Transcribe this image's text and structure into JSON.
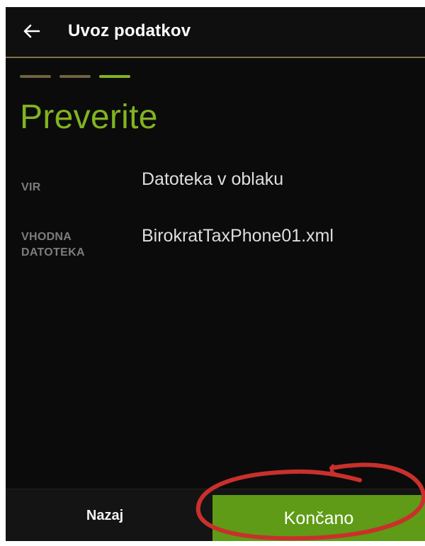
{
  "app_bar": {
    "title": "Uvoz podatkov",
    "back_icon": "arrow-left-icon"
  },
  "stepper": {
    "steps_total": 3,
    "current_step": 3,
    "colors": {
      "done": "#6f6240",
      "active": "#82b320"
    }
  },
  "main": {
    "heading": "Preverite",
    "rows": [
      {
        "label": "VIR",
        "value": "Datoteka v oblaku"
      },
      {
        "label": "VHODNA\nDATOTEKA",
        "value": "BirokratTaxPhone01.xml"
      }
    ]
  },
  "footer": {
    "back_label": "Nazaj",
    "finish_label": "Končano"
  },
  "colors": {
    "accent": "#82b320",
    "background": "#0b0b0b",
    "finish_button": "#5f9b16",
    "annotation_circle": "#c9302c"
  }
}
